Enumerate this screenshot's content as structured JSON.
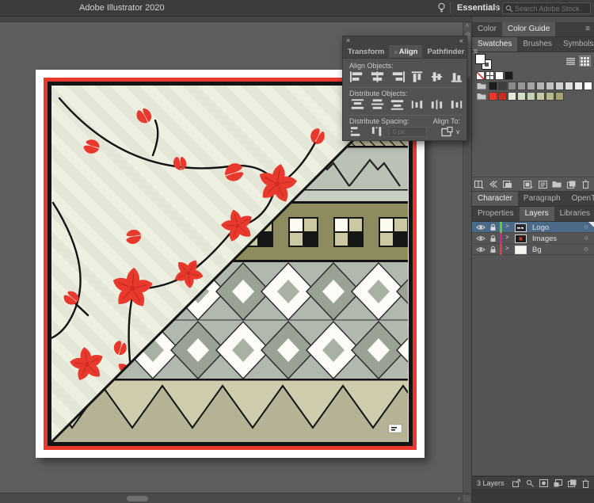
{
  "titlebar": {
    "title": "Adobe Illustrator 2020",
    "workspace": "Essentials",
    "search_placeholder": "Search Adobe Stock"
  },
  "icons": {
    "menu": "≡",
    "close": "×",
    "collapse": "«",
    "dot": "○",
    "target": "○",
    "disclosure": ">",
    "chevron": "∨",
    "scroll_up": "∧",
    "scroll_down": "∨",
    "scroll_right": "›"
  },
  "align_panel": {
    "tabs": [
      "Transform",
      "Align",
      "Pathfinder"
    ],
    "active_tab": "Align",
    "align_objects_label": "Align Objects:",
    "distribute_objects_label": "Distribute Objects:",
    "distribute_spacing_label": "Distribute Spacing:",
    "align_to_label": "Align To:",
    "spacing_value": "0 px"
  },
  "right_panel": {
    "tabs_color": [
      "Color",
      "Color Guide"
    ],
    "active_color_tab": "Color Guide",
    "tabs_swatch": [
      "Swatches",
      "Brushes",
      "Symbols"
    ],
    "active_swatch_tab": "Swatches",
    "tabs_type": [
      "Character",
      "Paragraph",
      "OpenType"
    ],
    "active_type_tab": "Character",
    "tabs_main": [
      "Properties",
      "Layers",
      "Libraries"
    ],
    "active_main_tab": "Layers",
    "swatches": {
      "basic": [
        "none",
        "registration",
        "#ffffff",
        "#1a1a1a"
      ],
      "grays": [
        "#1d1d1d",
        "#3f3f3f",
        "#8a8a8a",
        "#979797",
        "#a5a5a5",
        "#b3b3b3",
        "#c1c1c1",
        "#d0d0d0",
        "#dfdfdf",
        "#eeeeee",
        "#ffffff"
      ],
      "brand": [
        "#e8392c",
        "#c52f23",
        "#e4e8d7",
        "#d4dcc7",
        "#c6cfb8",
        "#c4c9a4",
        "#b5b98e",
        "#a5a374"
      ]
    },
    "layers": [
      {
        "name": "Logo",
        "color": "#52d336"
      },
      {
        "name": "Images",
        "color": "#e0218a"
      },
      {
        "name": "Bg",
        "color": "#e03a4e"
      }
    ],
    "status": "3 Layers"
  },
  "artwork": {
    "palette": {
      "background_sage": "#e4e7d8",
      "stripe_light": "#edefe1",
      "flower_red": "#e8392c",
      "branch_black": "#141414",
      "frame_red": "#e8392c",
      "frame_black": "#141414",
      "band_tan_hatch": "#ddd8b6",
      "band_gray_green": "#bac1b5",
      "band_olive": "#8e8c5f",
      "band_gray": "#b1b8ad",
      "zigzag_light": "#cfcbad",
      "zigzag_dark": "#b6b295",
      "checker_white": "#fbfbef",
      "checker_tan": "#cbc8a2",
      "diamond_dark": "#99a295",
      "diamond_white": "#fbfcf6"
    }
  }
}
